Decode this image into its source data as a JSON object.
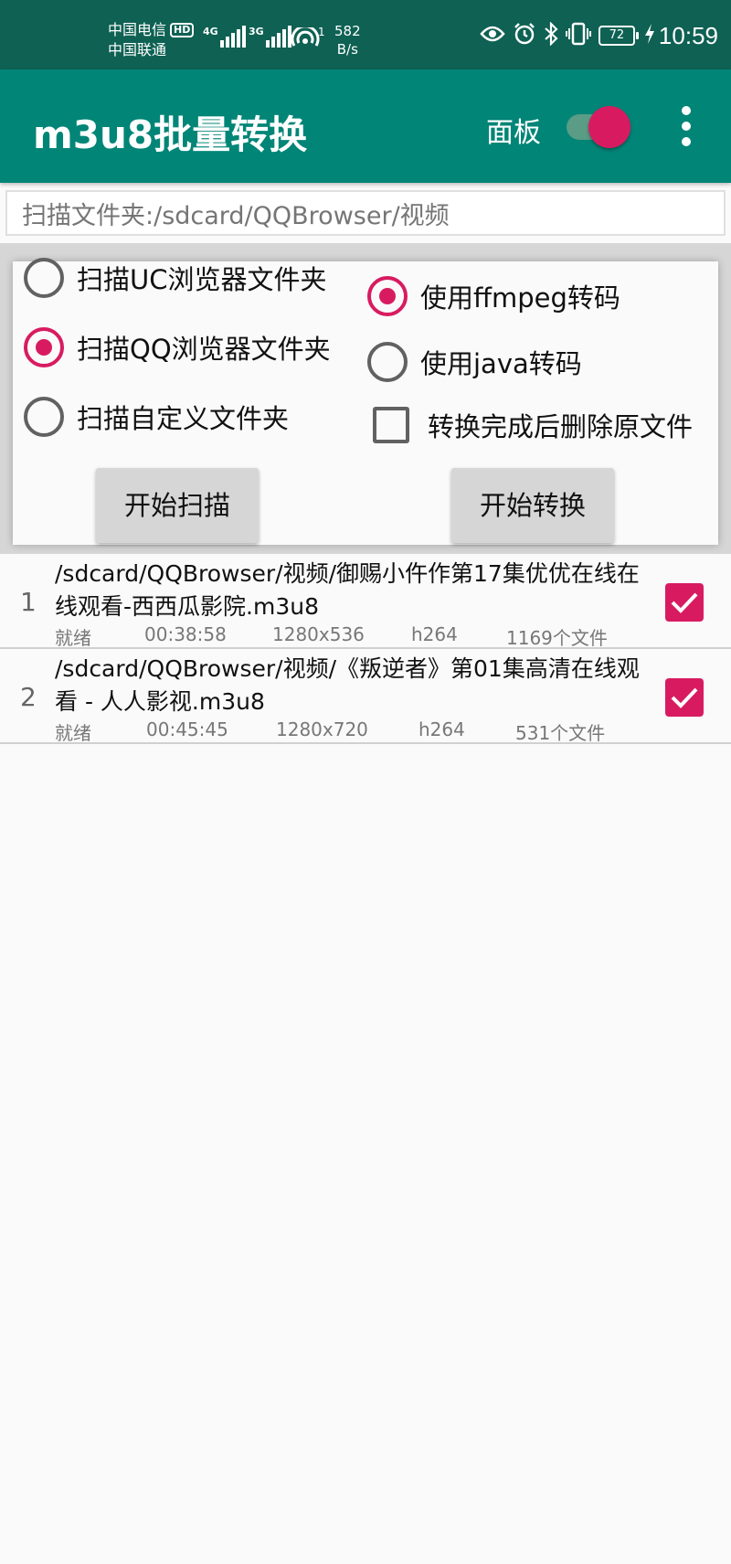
{
  "status_bar": {
    "carrier_1": "中国电信",
    "hd_badge": "HD",
    "carrier_2": "中国联通",
    "signal_1_type": "4G",
    "signal_2_type": "3G",
    "hotspot_count": "1",
    "speed_value": "582",
    "speed_unit": "B/s",
    "battery": "72",
    "time": "10:59",
    "icons": [
      "eye-icon",
      "alarm-icon",
      "bluetooth-icon",
      "vibrate-icon",
      "battery-icon",
      "charging-icon"
    ]
  },
  "app_bar": {
    "title": "m3u8批量转换",
    "panel_label": "面板",
    "panel_switch_on": true
  },
  "scan_path": {
    "value": "扫描文件夹:/sdcard/QQBrowser/视频"
  },
  "options": {
    "scan_uc": {
      "label": "扫描UC浏览器文件夹",
      "selected": false
    },
    "scan_qq": {
      "label": "扫描QQ浏览器文件夹",
      "selected": true
    },
    "scan_custom": {
      "label": "扫描自定义文件夹",
      "selected": false
    },
    "use_ffmpeg": {
      "label": "使用ffmpeg转码",
      "selected": true
    },
    "use_java": {
      "label": "使用java转码",
      "selected": false
    },
    "delete_after": {
      "label": "转换完成后删除原文件",
      "checked": false
    },
    "start_scan_label": "开始扫描",
    "start_convert_label": "开始转换"
  },
  "files": [
    {
      "index": "1",
      "name": "/sdcard/QQBrowser/视频/御赐小仵作第17集优优在线在线观看-西西瓜影院.m3u8",
      "status": "就绪",
      "duration": "00:38:58",
      "resolution": "1280x536",
      "codec": "h264",
      "file_count": "1169个文件",
      "checked": true
    },
    {
      "index": "2",
      "name": "/sdcard/QQBrowser/视频/《叛逆者》第01集高清在线观看 - 人人影视.m3u8",
      "status": "就绪",
      "duration": "00:45:45",
      "resolution": "1280x720",
      "codec": "h264",
      "file_count": "531个文件",
      "checked": true
    }
  ],
  "colors": {
    "status_bar": "#0e6153",
    "primary": "#008577",
    "accent": "#d81b60"
  }
}
